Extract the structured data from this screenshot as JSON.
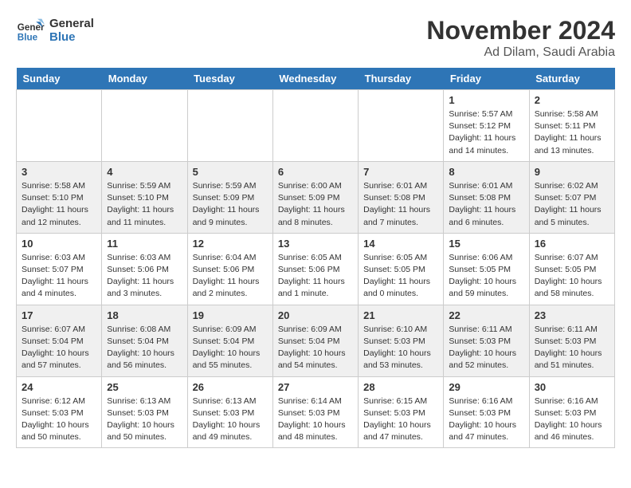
{
  "logo": {
    "line1": "General",
    "line2": "Blue"
  },
  "title": "November 2024",
  "subtitle": "Ad Dilam, Saudi Arabia",
  "days_of_week": [
    "Sunday",
    "Monday",
    "Tuesday",
    "Wednesday",
    "Thursday",
    "Friday",
    "Saturday"
  ],
  "weeks": [
    [
      {
        "day": "",
        "info": ""
      },
      {
        "day": "",
        "info": ""
      },
      {
        "day": "",
        "info": ""
      },
      {
        "day": "",
        "info": ""
      },
      {
        "day": "",
        "info": ""
      },
      {
        "day": "1",
        "info": "Sunrise: 5:57 AM\nSunset: 5:12 PM\nDaylight: 11 hours and 14 minutes."
      },
      {
        "day": "2",
        "info": "Sunrise: 5:58 AM\nSunset: 5:11 PM\nDaylight: 11 hours and 13 minutes."
      }
    ],
    [
      {
        "day": "3",
        "info": "Sunrise: 5:58 AM\nSunset: 5:10 PM\nDaylight: 11 hours and 12 minutes."
      },
      {
        "day": "4",
        "info": "Sunrise: 5:59 AM\nSunset: 5:10 PM\nDaylight: 11 hours and 11 minutes."
      },
      {
        "day": "5",
        "info": "Sunrise: 5:59 AM\nSunset: 5:09 PM\nDaylight: 11 hours and 9 minutes."
      },
      {
        "day": "6",
        "info": "Sunrise: 6:00 AM\nSunset: 5:09 PM\nDaylight: 11 hours and 8 minutes."
      },
      {
        "day": "7",
        "info": "Sunrise: 6:01 AM\nSunset: 5:08 PM\nDaylight: 11 hours and 7 minutes."
      },
      {
        "day": "8",
        "info": "Sunrise: 6:01 AM\nSunset: 5:08 PM\nDaylight: 11 hours and 6 minutes."
      },
      {
        "day": "9",
        "info": "Sunrise: 6:02 AM\nSunset: 5:07 PM\nDaylight: 11 hours and 5 minutes."
      }
    ],
    [
      {
        "day": "10",
        "info": "Sunrise: 6:03 AM\nSunset: 5:07 PM\nDaylight: 11 hours and 4 minutes."
      },
      {
        "day": "11",
        "info": "Sunrise: 6:03 AM\nSunset: 5:06 PM\nDaylight: 11 hours and 3 minutes."
      },
      {
        "day": "12",
        "info": "Sunrise: 6:04 AM\nSunset: 5:06 PM\nDaylight: 11 hours and 2 minutes."
      },
      {
        "day": "13",
        "info": "Sunrise: 6:05 AM\nSunset: 5:06 PM\nDaylight: 11 hours and 1 minute."
      },
      {
        "day": "14",
        "info": "Sunrise: 6:05 AM\nSunset: 5:05 PM\nDaylight: 11 hours and 0 minutes."
      },
      {
        "day": "15",
        "info": "Sunrise: 6:06 AM\nSunset: 5:05 PM\nDaylight: 10 hours and 59 minutes."
      },
      {
        "day": "16",
        "info": "Sunrise: 6:07 AM\nSunset: 5:05 PM\nDaylight: 10 hours and 58 minutes."
      }
    ],
    [
      {
        "day": "17",
        "info": "Sunrise: 6:07 AM\nSunset: 5:04 PM\nDaylight: 10 hours and 57 minutes."
      },
      {
        "day": "18",
        "info": "Sunrise: 6:08 AM\nSunset: 5:04 PM\nDaylight: 10 hours and 56 minutes."
      },
      {
        "day": "19",
        "info": "Sunrise: 6:09 AM\nSunset: 5:04 PM\nDaylight: 10 hours and 55 minutes."
      },
      {
        "day": "20",
        "info": "Sunrise: 6:09 AM\nSunset: 5:04 PM\nDaylight: 10 hours and 54 minutes."
      },
      {
        "day": "21",
        "info": "Sunrise: 6:10 AM\nSunset: 5:03 PM\nDaylight: 10 hours and 53 minutes."
      },
      {
        "day": "22",
        "info": "Sunrise: 6:11 AM\nSunset: 5:03 PM\nDaylight: 10 hours and 52 minutes."
      },
      {
        "day": "23",
        "info": "Sunrise: 6:11 AM\nSunset: 5:03 PM\nDaylight: 10 hours and 51 minutes."
      }
    ],
    [
      {
        "day": "24",
        "info": "Sunrise: 6:12 AM\nSunset: 5:03 PM\nDaylight: 10 hours and 50 minutes."
      },
      {
        "day": "25",
        "info": "Sunrise: 6:13 AM\nSunset: 5:03 PM\nDaylight: 10 hours and 50 minutes."
      },
      {
        "day": "26",
        "info": "Sunrise: 6:13 AM\nSunset: 5:03 PM\nDaylight: 10 hours and 49 minutes."
      },
      {
        "day": "27",
        "info": "Sunrise: 6:14 AM\nSunset: 5:03 PM\nDaylight: 10 hours and 48 minutes."
      },
      {
        "day": "28",
        "info": "Sunrise: 6:15 AM\nSunset: 5:03 PM\nDaylight: 10 hours and 47 minutes."
      },
      {
        "day": "29",
        "info": "Sunrise: 6:16 AM\nSunset: 5:03 PM\nDaylight: 10 hours and 47 minutes."
      },
      {
        "day": "30",
        "info": "Sunrise: 6:16 AM\nSunset: 5:03 PM\nDaylight: 10 hours and 46 minutes."
      }
    ]
  ]
}
